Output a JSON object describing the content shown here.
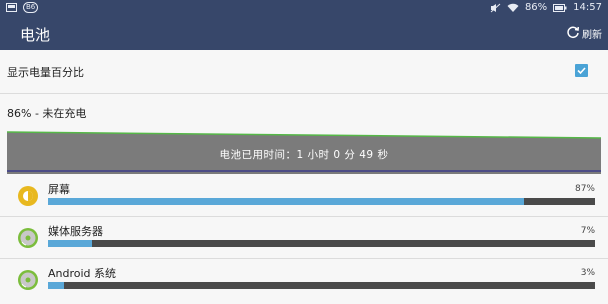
{
  "status_bar": {
    "battery_percent_text": "86%",
    "time": "14:57",
    "left_badge": "B6"
  },
  "header": {
    "title": "电池",
    "refresh_label": "刷新"
  },
  "settings": {
    "show_percent_label": "显示电量百分比",
    "show_percent_checked": true,
    "status_text": "86% - 未在充电"
  },
  "usage_graph": {
    "summary_text": "电池已用时间：1 小时 0 分 49 秒"
  },
  "items": [
    {
      "name": "屏幕",
      "percent_text": "87%",
      "fraction": 0.87,
      "icon": "screen-brightness-icon"
    },
    {
      "name": "媒体服务器",
      "percent_text": "7%",
      "fraction": 0.08,
      "icon": "android-disc-icon"
    },
    {
      "name": "Android 系统",
      "percent_text": "3%",
      "fraction": 0.03,
      "icon": "android-disc-icon"
    }
  ],
  "colors": {
    "header_bg": "#37476a",
    "accent": "#4aa3d6",
    "bar_fill": "#5aa8d8",
    "graph_fill": "#7b7b7b",
    "graph_line": "#55b847"
  }
}
